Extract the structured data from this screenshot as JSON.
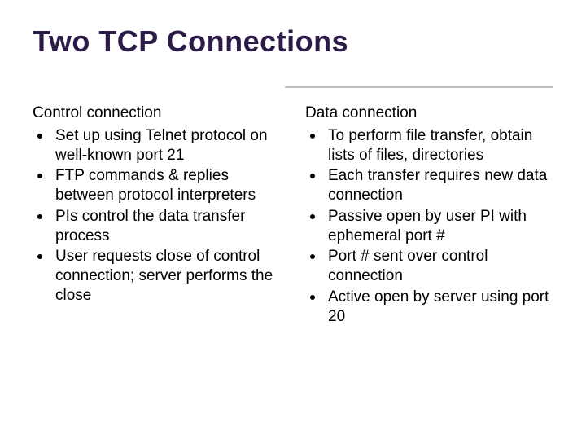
{
  "title": "Two TCP Connections",
  "left": {
    "header": "Control connection",
    "items": [
      "Set up using Telnet protocol on well-known port 21",
      "FTP commands & replies between protocol interpreters",
      "PIs control the data transfer process",
      "User requests close of control connection; server performs the close"
    ]
  },
  "right": {
    "header": "Data connection",
    "items": [
      "To perform file transfer, obtain lists of files, directories",
      "Each transfer requires new data connection",
      "Passive open by user PI with ephemeral port #",
      "Port # sent over control connection",
      " Active open by server using port 20"
    ]
  }
}
